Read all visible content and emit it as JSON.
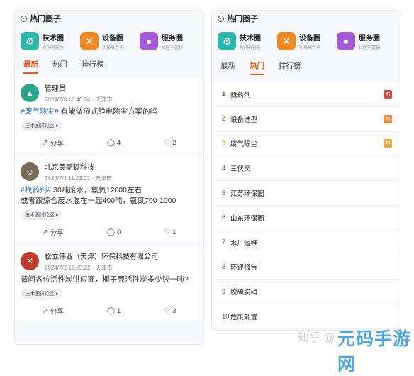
{
  "left_panel": {
    "title": "热门圈子",
    "circles": [
      {
        "name": "技术圈",
        "desc": "有问有答全",
        "icon": "gear-icon",
        "color": "#2bb8a8",
        "glyph": "⚙"
      },
      {
        "name": "设备圈",
        "desc": "实操高手多",
        "icon": "tools-icon",
        "color": "#f08a24",
        "glyph": "✕"
      },
      {
        "name": "服务圈",
        "desc": "社区丰富快",
        "icon": "person-icon",
        "color": "#a35bd6",
        "glyph": "●"
      }
    ],
    "tabs": [
      "最新",
      "热门",
      "排行榜"
    ],
    "posts": [
      {
        "user": "管理员",
        "time": "2024/7/3 13:40:24 · 天津市",
        "tag": "#废气除尘#",
        "text": " 有能做湿式静电除尘方案的吗",
        "text2": "",
        "chip": "技术圈讨论区 ▸",
        "share": "分享",
        "comments": "4",
        "likes": "2",
        "avatar_color": "#2aa38b",
        "avatar_glyph": "▲"
      },
      {
        "user": "北京美斯顿科技",
        "time": "2024/7/3 11:43:07 · 天津市",
        "tag": "#找药剂#",
        "text": " 30吨废水，氨氮12000左右",
        "text2": "或者跟综合废水混在一起400吨，氨氮700-1000",
        "chip": "技术圈讨论区 ▸",
        "share": "分享",
        "comments": "0",
        "likes": "1",
        "avatar_color": "#7a6a5a",
        "avatar_glyph": "☺"
      },
      {
        "user": "松立伟业（天津）环保科技有限公司",
        "time": "2024/7/2 12:25:22 · 天津市",
        "tag": "",
        "text": "请问各位活性炭供应商，椰子壳活性炭多少钱一吨?",
        "text2": "",
        "chip": "技术圈讨论区 ▸",
        "share": "分享",
        "comments": "1",
        "likes": "3",
        "avatar_color": "#c0392b",
        "avatar_glyph": "✕"
      }
    ],
    "share_icon": "share-icon",
    "comment_icon": "comment-icon",
    "like_icon": "like-icon"
  },
  "right_panel": {
    "title": "热门圈子",
    "circles": [
      {
        "name": "技术圈",
        "desc": "有问有答全",
        "icon": "gear-icon",
        "color": "#2bb8a8",
        "glyph": "⚙"
      },
      {
        "name": "设备圈",
        "desc": "实操高手多",
        "icon": "tools-icon",
        "color": "#f08a24",
        "glyph": "✕"
      },
      {
        "name": "服务圈",
        "desc": "社区丰富快",
        "icon": "person-icon",
        "color": "#a35bd6",
        "glyph": "●"
      }
    ],
    "tabs": [
      "最新",
      "热门",
      "排行榜"
    ],
    "ranking": [
      {
        "rank": "1",
        "name": "找药剂",
        "badge": "热",
        "badge_color": "#d9463a"
      },
      {
        "rank": "2",
        "name": "设备选型",
        "badge": "热",
        "badge_color": "#e8873a"
      },
      {
        "rank": "3",
        "name": "废气除尘",
        "badge": "热",
        "badge_color": "#eba940"
      },
      {
        "rank": "4",
        "name": "三伏天",
        "badge": ""
      },
      {
        "rank": "5",
        "name": "江苏环保圈",
        "badge": ""
      },
      {
        "rank": "6",
        "name": "山东环保圈",
        "badge": ""
      },
      {
        "rank": "7",
        "name": "水厂运维",
        "badge": ""
      },
      {
        "rank": "8",
        "name": "环评报告",
        "badge": ""
      },
      {
        "rank": "9",
        "name": "脱硫脱硝",
        "badge": ""
      },
      {
        "rank": "10",
        "name": "危废处置",
        "badge": ""
      }
    ]
  },
  "watermark": "知乎 @",
  "brand": "元码手游网"
}
